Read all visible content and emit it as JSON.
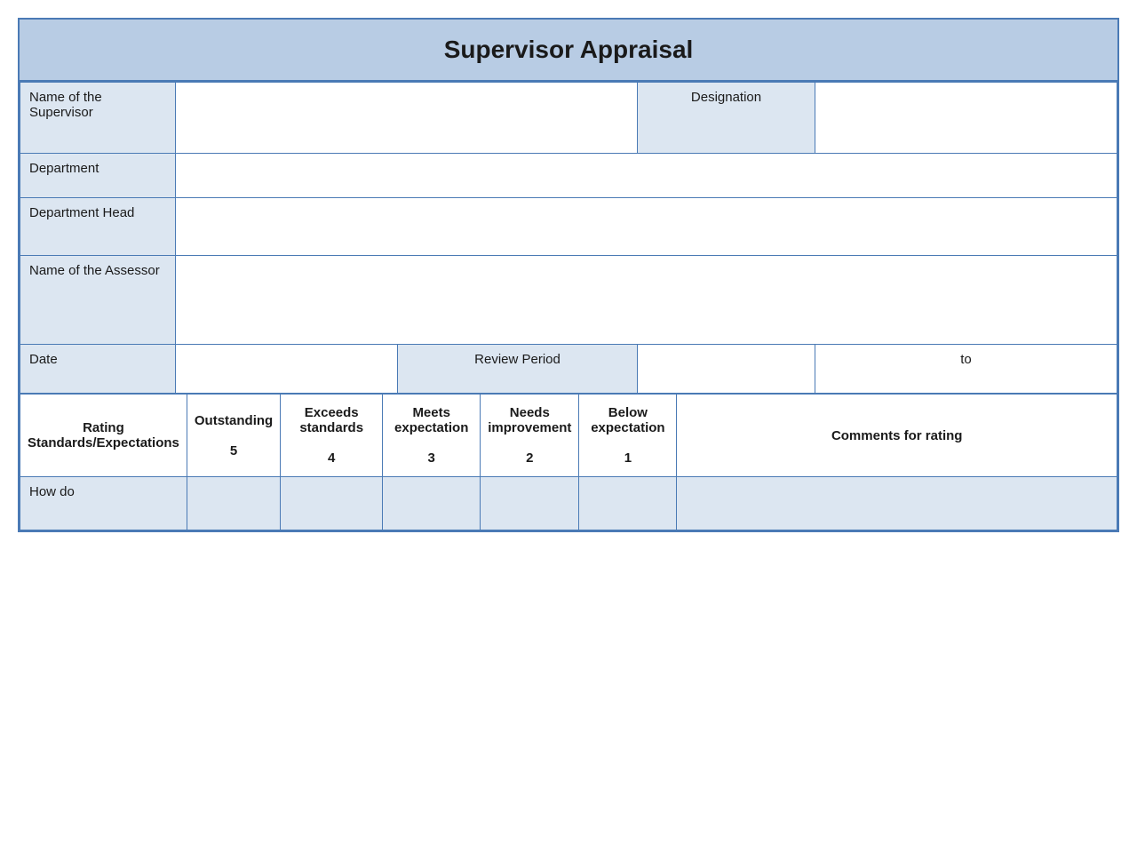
{
  "title": "Supervisor Appraisal",
  "form": {
    "supervisor_label": "Name of the Supervisor",
    "supervisor_value": "",
    "designation_label": "Designation",
    "designation_value": "",
    "department_label": "Department",
    "department_value": "",
    "dept_head_label": "Department Head",
    "dept_head_value": "",
    "assessor_label": "Name of the Assessor",
    "assessor_value": "",
    "date_label": "Date",
    "date_value": "",
    "review_period_label": "Review Period",
    "review_period_value": "",
    "to_label": "to",
    "to_value": ""
  },
  "rating_table": {
    "col1_label": "Rating Standards/Expectations",
    "col2_label": "Outstanding",
    "col2_score": "5",
    "col3_label": "Exceeds standards",
    "col3_score": "4",
    "col4_label": "Meets expectation",
    "col4_score": "3",
    "col5_label": "Needs improvement",
    "col5_score": "2",
    "col6_label": "Below expectation",
    "col6_score": "1",
    "col7_label": "Comments for rating",
    "first_row_label": "How do"
  }
}
